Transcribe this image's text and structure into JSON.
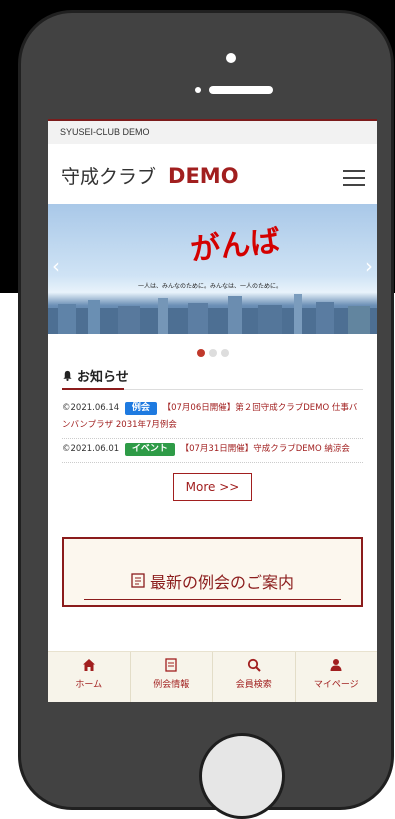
{
  "topbar": {
    "site_name": "SYUSEI-CLUB DEMO"
  },
  "header": {
    "logo_text": "守成クラブ",
    "logo_suffix": "DEMO"
  },
  "banner": {
    "headline": "がんばれ",
    "slogan": "一人は、みんなのために。みんなは、一人のために。",
    "arrow_left": "‹",
    "arrow_right": "›"
  },
  "carousel": {
    "dots": 3,
    "active_index": 0
  },
  "news": {
    "heading": "お知らせ",
    "items": [
      {
        "date": "©2021.06.14",
        "badge": "例会",
        "title": "【07月06日開催】第２回守成クラブDEMO 仕事バンバンプラザ 2031年7月例会"
      },
      {
        "date": "©2021.06.01",
        "badge": "イベント",
        "title": "【07月31日開催】守成クラブDEMO 納涼会"
      }
    ],
    "more_label": "More >>"
  },
  "meeting": {
    "title": "最新の例会のご案内"
  },
  "bottom_nav": [
    {
      "label": "ホーム",
      "icon": "home-icon"
    },
    {
      "label": "例会情報",
      "icon": "document-icon"
    },
    {
      "label": "会員検索",
      "icon": "search-icon"
    },
    {
      "label": "マイページ",
      "icon": "user-icon"
    }
  ],
  "colors": {
    "brand": "#a11f1f",
    "blue_badge": "#1e7ae0",
    "green_badge": "#2e9b47"
  }
}
